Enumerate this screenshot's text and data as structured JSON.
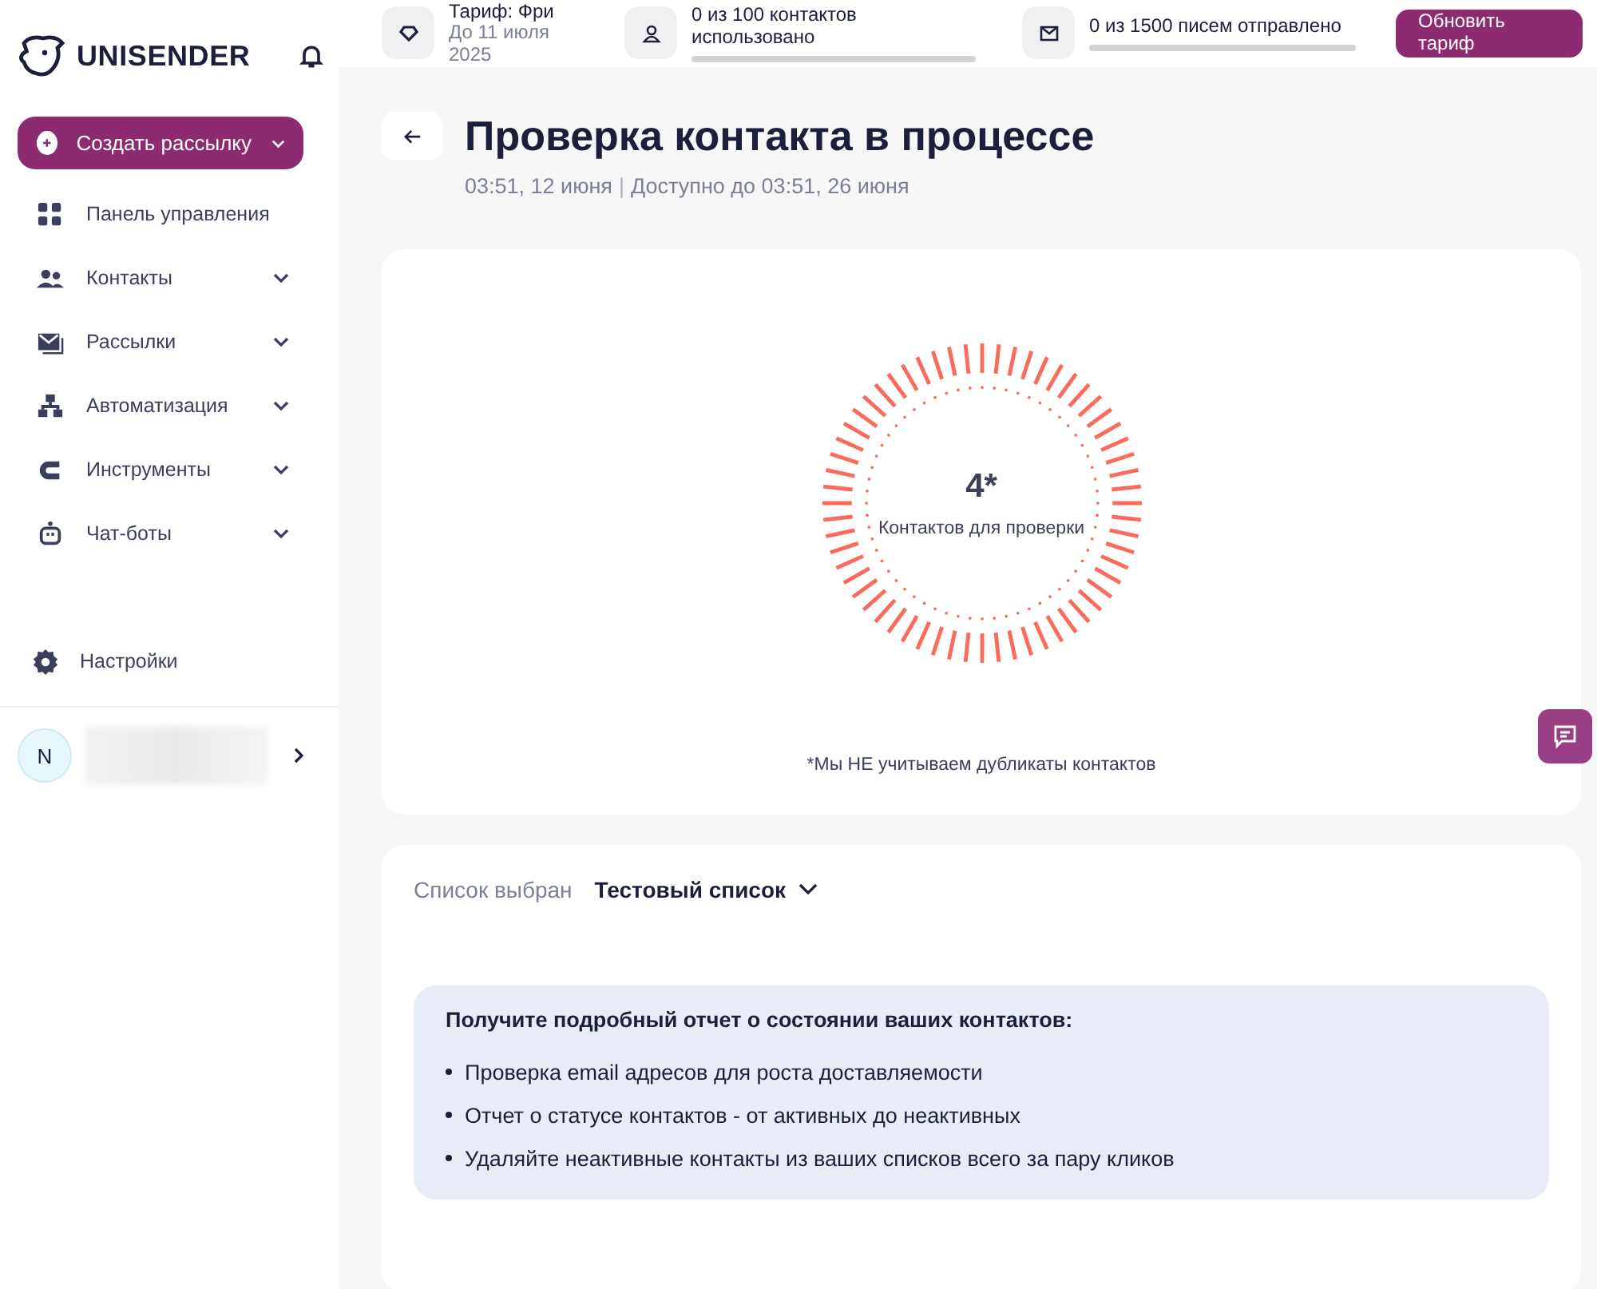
{
  "logo": {
    "text": "UNISENDER"
  },
  "header": {
    "plan": {
      "title": "Тариф: Фри",
      "until": "До 11 июля 2025"
    },
    "meters": [
      {
        "kind": "contacts",
        "text": "0 из 100 контактов использовано",
        "level": 0
      },
      {
        "kind": "letters",
        "text": "0 из 1500 писем отправлено",
        "level": 0
      }
    ],
    "upgrade_button": "Обновить тариф"
  },
  "sidebar": {
    "create_button": "Создать рассылку",
    "items": [
      {
        "kind": "dashboard",
        "label": "Панель управления",
        "expandable": false
      },
      {
        "kind": "contacts",
        "label": "Контакты",
        "expandable": true
      },
      {
        "kind": "mailings",
        "label": "Рассылки",
        "expandable": true
      },
      {
        "kind": "automation",
        "label": "Автоматизация",
        "expandable": true
      },
      {
        "kind": "tools",
        "label": "Инструменты",
        "expandable": true
      },
      {
        "kind": "chatbots",
        "label": "Чат-боты",
        "expandable": true
      }
    ],
    "settings": "Настройки",
    "user": {
      "initial": "N"
    }
  },
  "page": {
    "title": "Проверка контакта в процессе",
    "created": "03:51, 12 июня",
    "separator": "|",
    "available": "Доступно до 03:51, 26 июня"
  },
  "progress_card": {
    "count": "4*",
    "caption": "Контактов для проверки",
    "note": "*Мы НЕ учитываем дубликаты контактов"
  },
  "list_card": {
    "label": "Список выбран",
    "value": "Тестовый список",
    "info": {
      "title": "Получите подробный отчет о состоянии ваших контактов:",
      "bullets": [
        "Проверка email адресов для роста доставляемости",
        "Отчет о статусе контактов - от активных до неактивных",
        "Удаляйте неактивные контакты из ваших списков всего за пару кликов"
      ]
    }
  }
}
